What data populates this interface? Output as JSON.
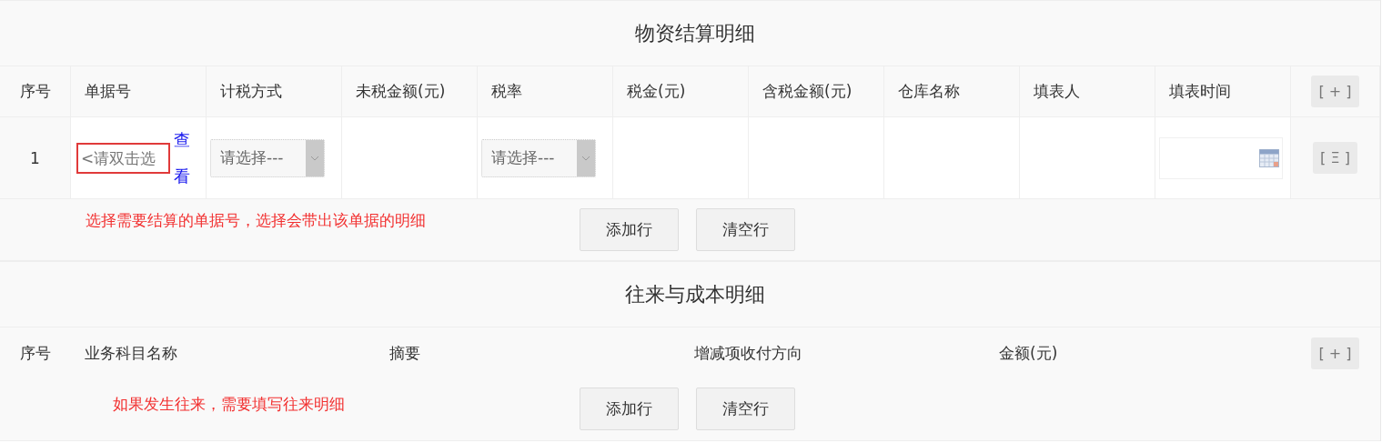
{
  "sections": [
    {
      "title": "物资结算明细",
      "columns": [
        "序号",
        "单据号",
        "计税方式",
        "未税金额(元)",
        "税率",
        "税金(元)",
        "含税金额(元)",
        "仓库名称",
        "填表人",
        "填表时间"
      ],
      "header_action": "[ + ]",
      "rows": [
        {
          "cells": [
            {
              "kind": "index",
              "text": "1"
            },
            {
              "kind": "picker",
              "placeholder": "<请双击选",
              "link": "查看"
            },
            {
              "kind": "select",
              "placeholder": "请选择---"
            },
            {
              "kind": "blank"
            },
            {
              "kind": "select",
              "placeholder": "请选择---"
            },
            {
              "kind": "blank"
            },
            {
              "kind": "blank"
            },
            {
              "kind": "blank"
            },
            {
              "kind": "blank"
            },
            {
              "kind": "date"
            }
          ],
          "action": "[ Ξ ]"
        }
      ],
      "hint": "选择需要结算的单据号，选择会带出该单据的明细",
      "buttons": [
        "添加行",
        "清空行"
      ]
    },
    {
      "title": "往来与成本明细",
      "columns": [
        "序号",
        "业务科目名称",
        "摘要",
        "增减项收付方向",
        "金额(元)"
      ],
      "header_action": "[ + ]",
      "hint": "如果发生往来，需要填写往来明细",
      "buttons": [
        "添加行",
        "清空行"
      ]
    }
  ]
}
